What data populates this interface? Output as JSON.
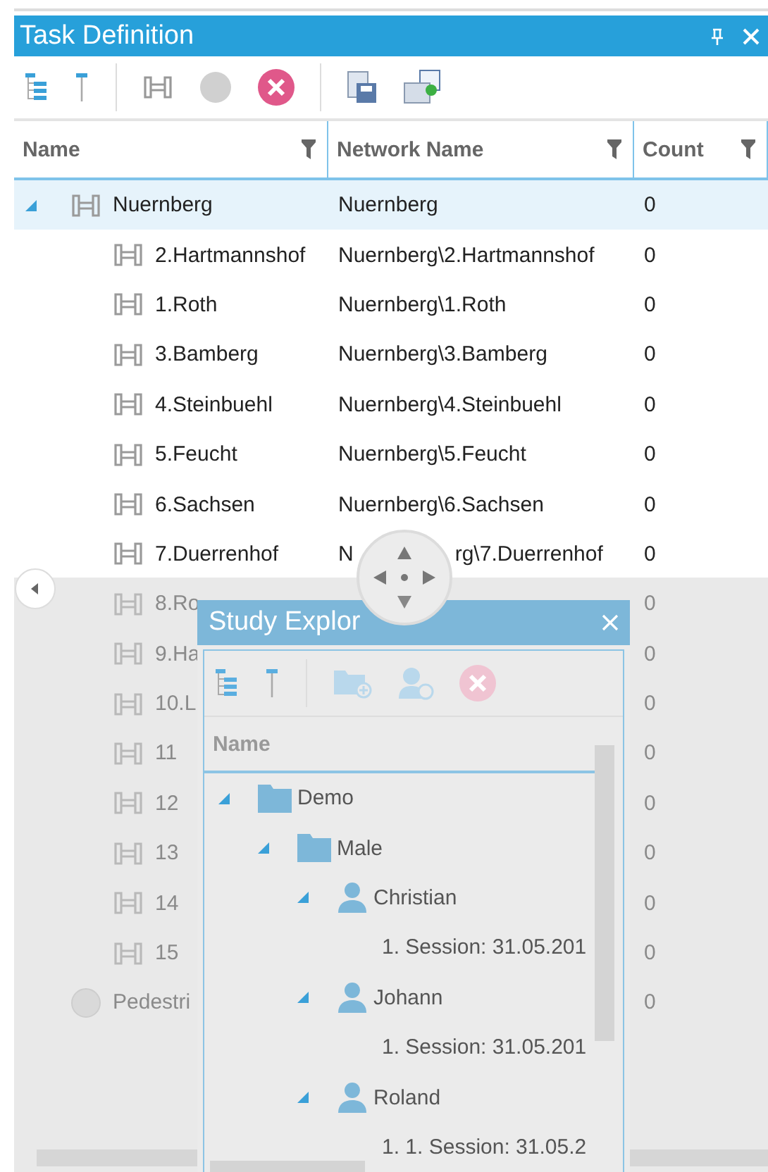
{
  "panel": {
    "title": "Task Definition",
    "columns": [
      "Name",
      "Network Name",
      "Count"
    ],
    "rows": [
      {
        "name": "Nuernberg",
        "network": "Nuernberg",
        "count": "0",
        "kind": "station",
        "expanded": true,
        "selected": true,
        "dimmed": false,
        "children": [
          {
            "name": "2.Hartmannshof",
            "network": "Nuernberg\\2.Hartmannshof",
            "count": "0",
            "kind": "station",
            "selected": false,
            "dimmed": false
          },
          {
            "name": "1.Roth",
            "network": "Nuernberg\\1.Roth",
            "count": "0",
            "kind": "station",
            "selected": false,
            "dimmed": false
          },
          {
            "name": "3.Bamberg",
            "network": "Nuernberg\\3.Bamberg",
            "count": "0",
            "kind": "station",
            "selected": false,
            "dimmed": false
          },
          {
            "name": "4.Steinbuehl",
            "network": "Nuernberg\\4.Steinbuehl",
            "count": "0",
            "kind": "station",
            "selected": false,
            "dimmed": false
          },
          {
            "name": "5.Feucht",
            "network": "Nuernberg\\5.Feucht",
            "count": "0",
            "kind": "station",
            "selected": false,
            "dimmed": false
          },
          {
            "name": "6.Sachsen",
            "network": "Nuernberg\\6.Sachsen",
            "count": "0",
            "kind": "station",
            "selected": false,
            "dimmed": false
          },
          {
            "name": "7.Duerrenhof",
            "network": "N",
            "network_tail": "rg\\7.Duerrenhof",
            "count": "0",
            "kind": "station",
            "selected": false,
            "dimmed": false
          },
          {
            "name": "8.Ro",
            "count": "0",
            "kind": "station",
            "selected": false,
            "dimmed": true
          },
          {
            "name": "9.Ha",
            "count": "0",
            "kind": "station",
            "selected": false,
            "dimmed": true
          },
          {
            "name": "10.L",
            "count": "0",
            "kind": "station",
            "selected": false,
            "dimmed": true
          },
          {
            "name": "11",
            "count": "0",
            "kind": "station",
            "selected": false,
            "dimmed": true
          },
          {
            "name": "12",
            "count": "0",
            "kind": "station",
            "selected": false,
            "dimmed": true
          },
          {
            "name": "13",
            "count": "0",
            "kind": "station",
            "selected": false,
            "dimmed": true
          },
          {
            "name": "14",
            "count": "0",
            "kind": "station",
            "selected": false,
            "dimmed": true
          },
          {
            "name": "15",
            "count": "0",
            "kind": "station",
            "selected": false,
            "dimmed": true
          }
        ]
      },
      {
        "name": "Pedestri",
        "count": "0",
        "kind": "pedestrian",
        "selected": false,
        "dimmed": true
      }
    ]
  },
  "study_explorer": {
    "title": "Study Explor",
    "column": "Name",
    "tree": [
      {
        "name": "Demo",
        "kind": "folder",
        "expanded": true,
        "children": [
          {
            "name": "Male",
            "kind": "folder",
            "expanded": true,
            "children": [
              {
                "name": "Christian",
                "kind": "person",
                "expanded": true,
                "children": [
                  {
                    "name": "1. Session: 31.05.201",
                    "kind": "session"
                  }
                ]
              },
              {
                "name": "Johann",
                "kind": "person",
                "expanded": true,
                "children": [
                  {
                    "name": "1. Session: 31.05.201",
                    "kind": "session"
                  }
                ]
              },
              {
                "name": "Roland",
                "kind": "person",
                "expanded": true,
                "children": [
                  {
                    "name": "1. 1. Session: 31.05.2",
                    "kind": "session"
                  }
                ]
              }
            ]
          }
        ]
      }
    ]
  }
}
